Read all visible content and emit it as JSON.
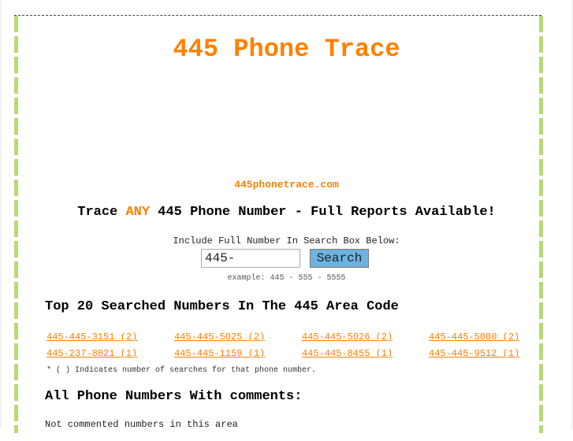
{
  "header": {
    "title": "445 Phone Trace",
    "site_url": "445phonetrace.com"
  },
  "tagline": {
    "prefix": "Trace ",
    "highlight": "ANY",
    "suffix": " 445 Phone Number - Full Reports Available!"
  },
  "search": {
    "label": "Include Full Number In Search Box Below:",
    "input_value": "445-",
    "button_label": "Search",
    "example": "example: 445 - 555 - 5555"
  },
  "top_numbers": {
    "heading": "Top 20 Searched Numbers In The 445 Area Code",
    "items": [
      "445-445-3151 (2)",
      "445-445-5025 (2)",
      "445-445-5026 (2)",
      "445-445-5080 (2)",
      "445-237-8021 (1)",
      "445-445-1159 (1)",
      "445-445-8455 (1)",
      "445-445-9512 (1)"
    ],
    "note": "* ( ) Indicates number of searches for that phone number."
  },
  "comments": {
    "heading": "All Phone Numbers With comments:",
    "empty_message": "Not commented numbers in this area"
  },
  "colors": {
    "accent": "#ff8000",
    "border_green": "#b8da74",
    "button_blue": "#6cb3e0"
  }
}
